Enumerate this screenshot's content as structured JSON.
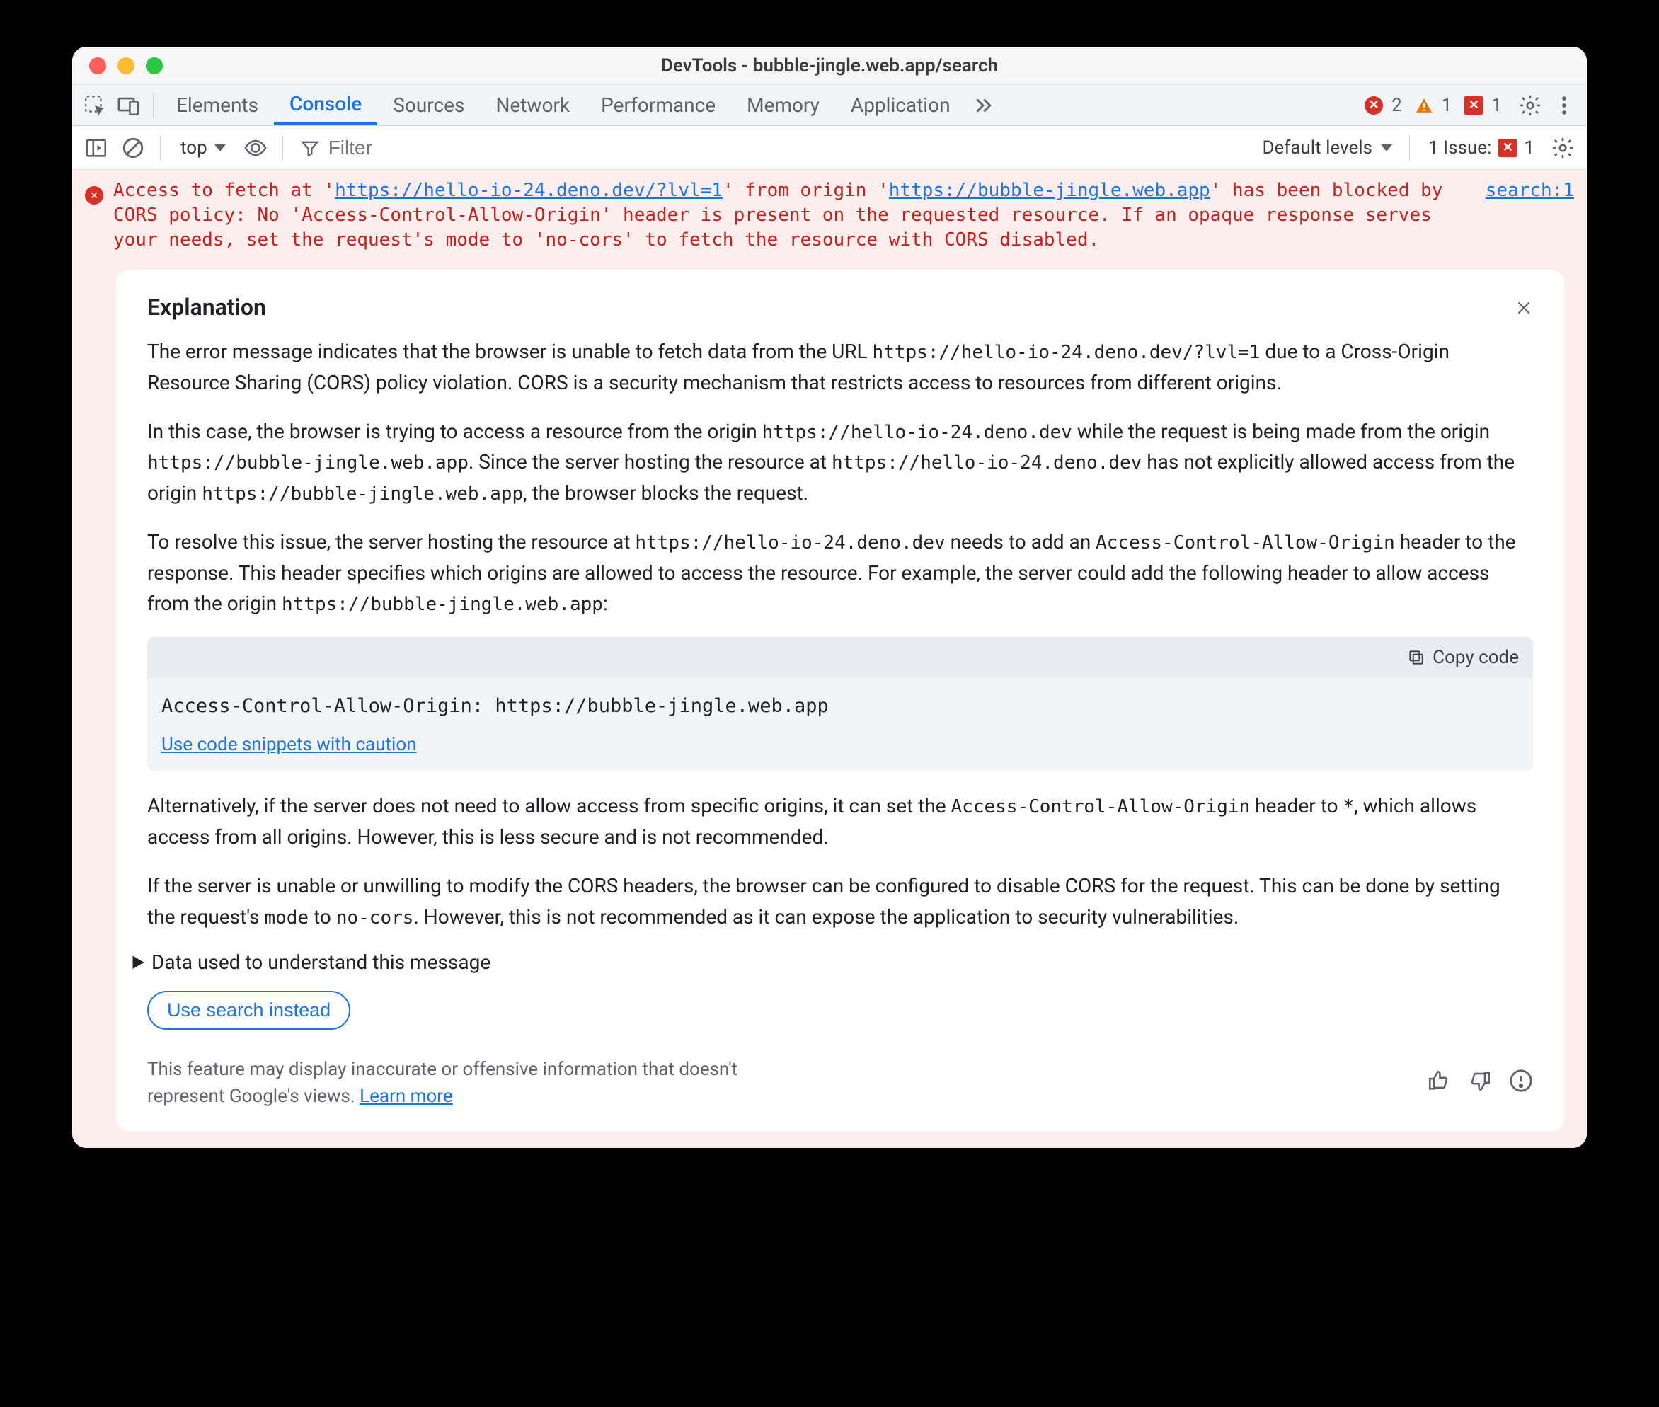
{
  "window": {
    "title": "DevTools - bubble-jingle.web.app/search"
  },
  "tabs": {
    "items": [
      "Elements",
      "Console",
      "Sources",
      "Network",
      "Performance",
      "Memory",
      "Application"
    ],
    "active": "Console"
  },
  "badges": {
    "errors": "2",
    "warnings": "1",
    "issues_badge": "1"
  },
  "subbar": {
    "context": "top",
    "filter_placeholder": "Filter",
    "levels": "Default levels",
    "issues_label": "1 Issue:",
    "issues_count": "1"
  },
  "error": {
    "pre1": "Access to fetch at '",
    "url1": "https://hello-io-24.deno.dev/?lvl=1",
    "mid1": "' from origin '",
    "url2": "https://bubble-jingle.web.app",
    "post1": "' has been blocked by CORS policy: No 'Access-Control-Allow-Origin' header is present on the requested resource. If an opaque response serves your needs, set the request's mode to 'no-cors' to fetch the resource with CORS disabled.",
    "source": "search:1"
  },
  "explain": {
    "heading": "Explanation",
    "p1a": "The error message indicates that the browser is unable to fetch data from the URL ",
    "p1_code1": "https://hello-io-24.deno.dev/?lvl=1",
    "p1b": " due to a Cross-Origin Resource Sharing (CORS) policy violation. CORS is a security mechanism that restricts access to resources from different origins.",
    "p2a": "In this case, the browser is trying to access a resource from the origin ",
    "p2_c1": "https://hello-io-24.deno.dev",
    "p2b": " while the request is being made from the origin ",
    "p2_c2": "https://bubble-jingle.web.app",
    "p2c": ". Since the server hosting the resource at ",
    "p2_c3": "https://hello-io-24.deno.dev",
    "p2d": " has not explicitly allowed access from the origin ",
    "p2_c4": "https://bubble-jingle.web.app",
    "p2e": ", the browser blocks the request.",
    "p3a": "To resolve this issue, the server hosting the resource at ",
    "p3_c1": "https://hello-io-24.deno.dev",
    "p3b": " needs to add an ",
    "p3_c2": "Access-Control-Allow-Origin",
    "p3c": " header to the response. This header specifies which origins are allowed to access the resource. For example, the server could add the following header to allow access from the origin ",
    "p3_c3": "https://bubble-jingle.web.app",
    "p3d": ":",
    "code_copy": "Copy code",
    "code_body": "Access-Control-Allow-Origin: https://bubble-jingle.web.app",
    "code_caution": "Use code snippets with caution",
    "p4a": "Alternatively, if the server does not need to allow access from specific origins, it can set the ",
    "p4_c1": "Access-Control-Allow-Origin",
    "p4b": " header to ",
    "p4_c2": "*",
    "p4c": ", which allows access from all origins. However, this is less secure and is not recommended.",
    "p5a": "If the server is unable or unwilling to modify the CORS headers, the browser can be configured to disable CORS for the request. This can be done by setting the request's ",
    "p5_c1": "mode",
    "p5b": " to ",
    "p5_c2": "no-cors",
    "p5c": ". However, this is not recommended as it can expose the application to security vulnerabilities.",
    "disclosure": "Data used to understand this message",
    "search_btn": "Use search instead",
    "disclaimer": "This feature may display inaccurate or offensive information that doesn't represent Google's views. ",
    "learn_more": "Learn more"
  }
}
